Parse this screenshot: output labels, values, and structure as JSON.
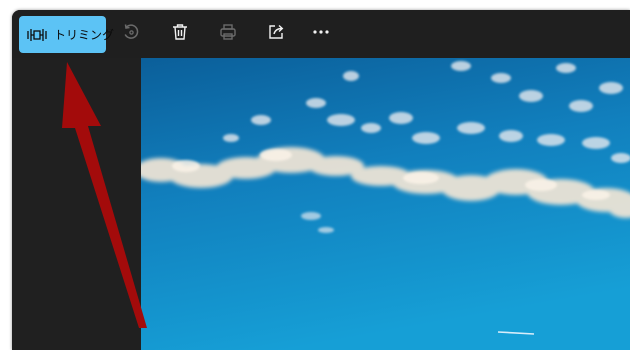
{
  "toolbar": {
    "trim_label": "トリミング",
    "buttons": {
      "trim": "crop-icon",
      "rotate": "rotate-icon",
      "delete": "trash-icon",
      "print": "printer-icon",
      "share": "share-icon",
      "more": "more-icon"
    }
  },
  "colors": {
    "accent": "#5cc3f5",
    "window_bg": "#1f1f1f",
    "annotation_arrow": "#a30b0b",
    "sky": "#0f8fc9"
  }
}
